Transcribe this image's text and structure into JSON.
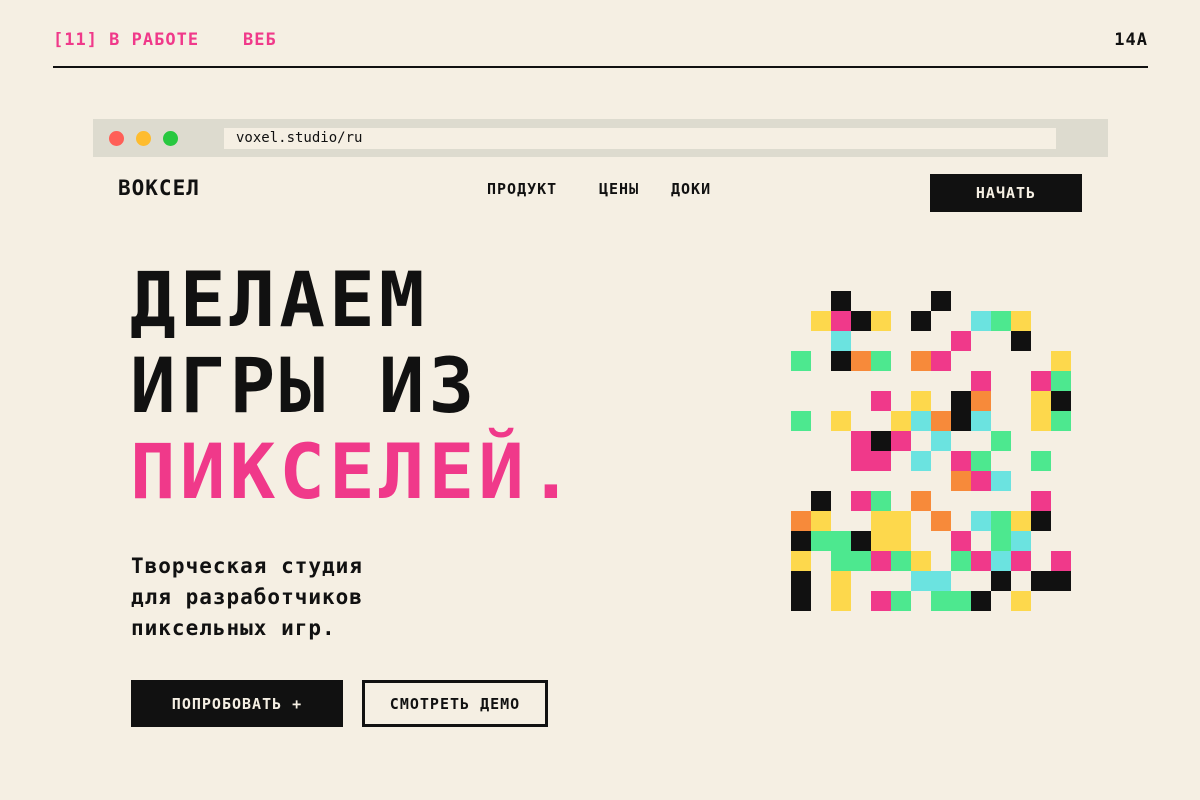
{
  "header": {
    "tag": "[11] В РАБОТЕ",
    "section": "ВЕБ",
    "code": "14A"
  },
  "browser": {
    "url": "voxel.studio/ru"
  },
  "site": {
    "logo": "ВОКСЕЛ",
    "nav": [
      "ПРОДУКТ",
      "ЦЕНЫ",
      "ДОКИ"
    ],
    "cta": "НАЧАТЬ"
  },
  "hero": {
    "line1": "ДЕЛАЕМ",
    "line2": "ИГРЫ ИЗ",
    "line3": "ПИКСЕЛЕЙ.",
    "subtitle_lines": [
      "Творческая студия",
      "для разработчиков",
      "пиксельных игр."
    ],
    "primary_button": "ПОПРОБОВАТЬ +",
    "secondary_button": "СМОТРЕТЬ ДЕМО"
  },
  "colors": {
    "background": "#f5efe3",
    "ink": "#111111",
    "accent_pink": "#f0398a",
    "pixel_palette": [
      "#111111",
      "#f0398a",
      "#fdd84c",
      "#4de88f",
      "#6be3e0",
      "#f78a3a"
    ]
  },
  "pixel_grid": {
    "rows": [
      "..k....k......",
      ".ypky.k..cgy..",
      "..c.....p..k..",
      "g.kog.ap.....y",
      ".........p..pgo",
      "....p.y.ka..yk",
      "g.y..ycakc..ygc",
      "...pkp.c..g...",
      "...pp.c.pg..g.",
      "........opc...",
      ".k.pg.a.....p.",
      "oy..yy.o.cgyd.",
      "kggkyy..p.gc..",
      "y.ggpgy.gpcp.p",
      "k.y...cc..d.kk",
      "k.y.pg.ggk.y..."
    ]
  }
}
